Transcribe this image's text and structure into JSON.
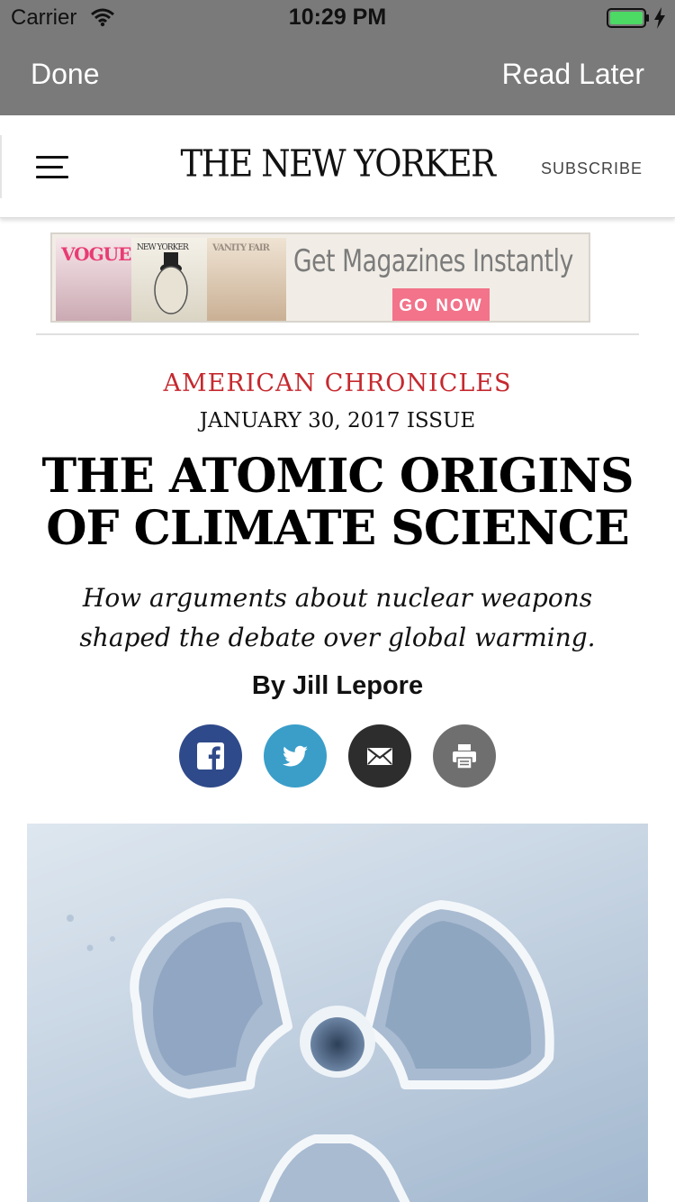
{
  "status_bar": {
    "carrier": "Carrier",
    "time": "10:29 PM",
    "battery_color": "#4cd964"
  },
  "nav_bar": {
    "done_label": "Done",
    "read_later_label": "Read Later"
  },
  "site_header": {
    "logo_text": "THE NEW YORKER",
    "subscribe_label": "SUBSCRIBE"
  },
  "ad": {
    "headline": "Get Magazines Instantly",
    "button_label": "GO NOW",
    "magazine_labels": [
      "VOGUE",
      "NEW YORKER",
      "VANITY FAIR"
    ]
  },
  "article": {
    "rubric": "AMERICAN CHRONICLES",
    "issue_date": "JANUARY 30, 2017 ISSUE",
    "headline": "THE ATOMIC ORIGINS OF CLIMATE SCIENCE",
    "dek": "How arguments about nuclear weapons shaped the debate over global warming.",
    "byline": "By Jill Lepore",
    "accent_color": "#c5292f",
    "share_buttons": [
      "facebook-icon",
      "twitter-icon",
      "email-icon",
      "print-icon"
    ]
  },
  "hero_image": {
    "subject": "radiation-symbol-in-snow"
  }
}
